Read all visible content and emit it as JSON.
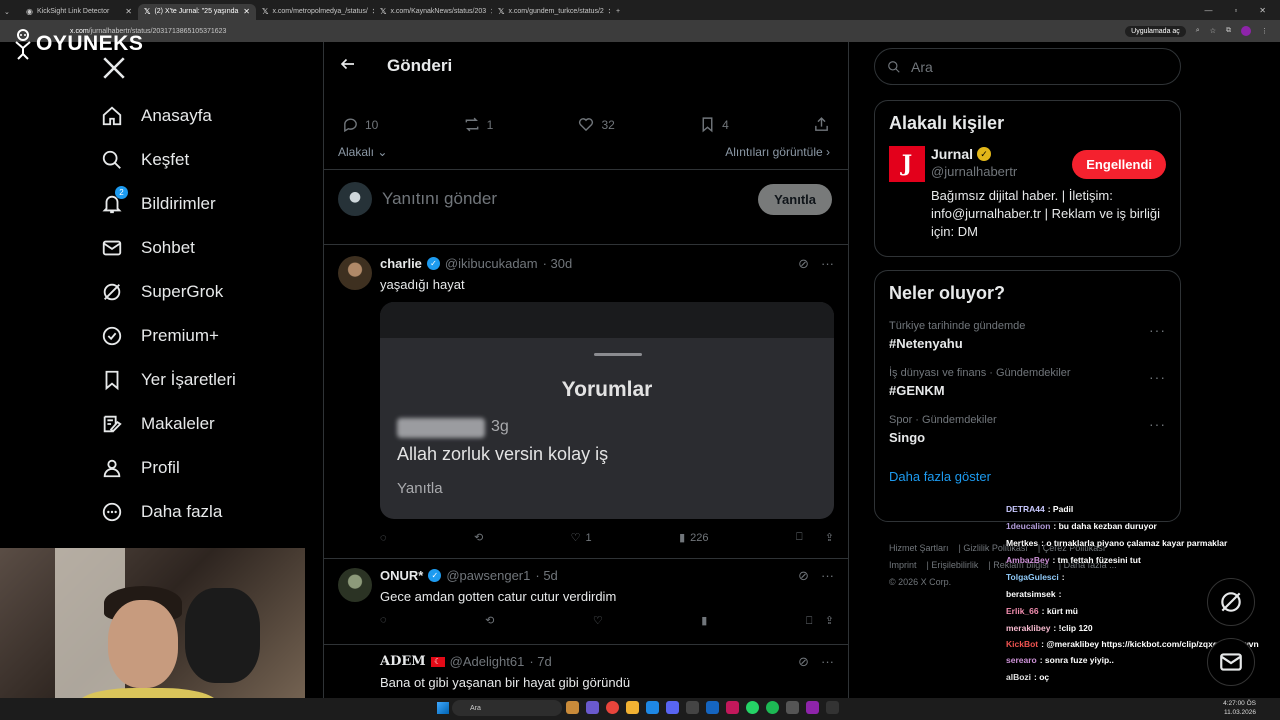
{
  "browser": {
    "tabs": [
      {
        "label": "KickSight Link Detector",
        "active": false
      },
      {
        "label": "(2) X'te Jurnal: \"25 yaşında",
        "active": true
      },
      {
        "label": "x.com/metropolmedya_/status/",
        "active": false
      },
      {
        "label": "x.com/KaynakNews/status/203",
        "active": false
      },
      {
        "label": "x.com/gundem_turkce/status/2",
        "active": false
      }
    ],
    "url_host": "x.com",
    "url_path": "/jurnalhabertr/status/2031713865105371623",
    "open_in_app": "Uygulamada aç"
  },
  "overlay_logo": "OYUNEKS",
  "nav": {
    "items": [
      {
        "label": "Anasayfa",
        "icon": "home-icon"
      },
      {
        "label": "Keşfet",
        "icon": "search-icon"
      },
      {
        "label": "Bildirimler",
        "icon": "bell-icon",
        "badge": "2"
      },
      {
        "label": "Sohbet",
        "icon": "mail-icon"
      },
      {
        "label": "SuperGrok",
        "icon": "grok-icon"
      },
      {
        "label": "Premium+",
        "icon": "verified-icon"
      },
      {
        "label": "Yer İşaretleri",
        "icon": "bookmark-icon"
      },
      {
        "label": "Makaleler",
        "icon": "article-icon"
      },
      {
        "label": "Profil",
        "icon": "profile-icon"
      },
      {
        "label": "Daha fazla",
        "icon": "more-icon"
      }
    ]
  },
  "post": {
    "header": "Gönderi",
    "stats": {
      "replies": "10",
      "reposts": "1",
      "likes": "32",
      "bookmarks": "4"
    },
    "sort_label": "Alakalı",
    "quotes_label": "Alıntıları görüntüle",
    "reply_placeholder": "Yanıtını gönder",
    "reply_button": "Yanıtla"
  },
  "replies": [
    {
      "name": "charlie",
      "handle": "@ikibucukadam",
      "time": "· 30d",
      "text": "yaşadığı hayat",
      "media": {
        "title": "Yorumlar",
        "age": "3g",
        "comment": "Allah zorluk versin kolay iş",
        "reply": "Yanıtla"
      },
      "actions": {
        "replies": "",
        "reposts": "",
        "likes": "1",
        "views": "226"
      }
    },
    {
      "name": "ONUR*",
      "handle": "@pawsenger1",
      "time": "· 5d",
      "text": "Gece amdan gotten catur cutur verdirdim"
    },
    {
      "name": "ADEM",
      "handle": "@Adelight61",
      "time": "· 7d",
      "text": "Bana ot gibi yaşanan bir hayat gibi göründü"
    }
  ],
  "right": {
    "search_placeholder": "Ara",
    "related_title": "Alakalı kişiler",
    "person": {
      "name": "Jurnal",
      "handle": "@jurnalhabertr",
      "bio": "Bağımsız dijital haber. | İletişim: info@jurnalhaber.tr | Reklam ve iş birliği için: DM",
      "button": "Engellendi",
      "logo_letter": "J"
    },
    "trends_title": "Neler oluyor?",
    "trends": [
      {
        "category": "Türkiye tarihinde gündemde",
        "name": "#Netenyahu"
      },
      {
        "category": "İş dünyası ve finans · Gündemdekiler",
        "name": "#GENKM"
      },
      {
        "category": "Spor · Gündemdekiler",
        "name": "Singo"
      }
    ],
    "show_more": "Daha fazla göster",
    "footer": [
      "Hizmet Şartları",
      "Gizlilik Politikası",
      "Çerez Politikası",
      "Imprint",
      "Erişilebilirlik",
      "Reklam bilgisi",
      "Daha fazla ...",
      "© 2026 X Corp."
    ]
  },
  "chat": [
    {
      "user": "DETRA44",
      "color": "#c9c9ff",
      "msg": ": Padil"
    },
    {
      "user": "1deucalion",
      "color": "#b39ddb",
      "msg": ": bu daha kezban duruyor"
    },
    {
      "user": "Mertkes",
      "color": "#ffffff",
      "msg": ": o tırnaklarla piyano çalamaz kayar parmaklar"
    },
    {
      "user": "AmbazBey",
      "color": "#ce93d8",
      "msg": ": tm fettah füzesini tut"
    },
    {
      "user": "TolgaGulesci",
      "color": "#90caf9",
      "msg": ":"
    },
    {
      "user": "beratsimsek",
      "color": "#ffffff",
      "msg": ":"
    },
    {
      "user": "Erlik_66",
      "color": "#f48fb1",
      "msg": ": kürt mü"
    },
    {
      "user": "meraklibey",
      "color": "#f8bbd0",
      "msg": ": !clip 120"
    },
    {
      "user": "KickBot",
      "color": "#ef5350",
      "msg": ": @meraklibey https://kickbot.com/clip/zqxqxvaq8wvn"
    },
    {
      "user": "serearo",
      "color": "#ce93d8",
      "msg": ": sonra fuze yiyip.."
    },
    {
      "user": "alBozi",
      "color": "#e0e0e0",
      "msg": ": oç"
    }
  ],
  "taskbar": {
    "search": "Ara",
    "time": "4:27:00 ÖS",
    "date": "11.03.2026"
  }
}
